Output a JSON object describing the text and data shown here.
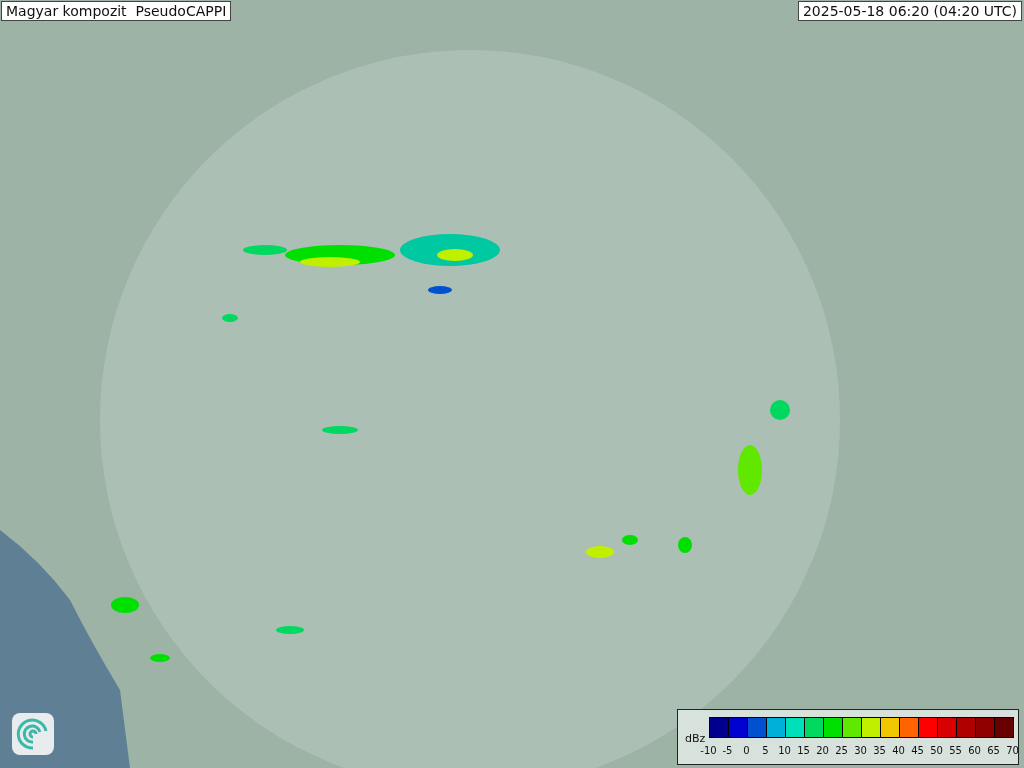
{
  "title": "Magyar kompozit  PseudoCAPPI",
  "timestamp": "2025-05-18 06:20 (04:20 UTC)",
  "legend": {
    "unit": "dBz",
    "bins": [
      {
        "color": "#00008c"
      },
      {
        "color": "#0000d0"
      },
      {
        "color": "#0050d0"
      },
      {
        "color": "#00b0d8"
      },
      {
        "color": "#00e0b8"
      },
      {
        "color": "#00d860"
      },
      {
        "color": "#00e000"
      },
      {
        "color": "#60e800"
      },
      {
        "color": "#c0f000"
      },
      {
        "color": "#f0c800"
      },
      {
        "color": "#ff6400"
      },
      {
        "color": "#ff0000"
      },
      {
        "color": "#d80000"
      },
      {
        "color": "#b00000"
      },
      {
        "color": "#900000"
      },
      {
        "color": "#680000"
      }
    ],
    "ticks": [
      "-10",
      "-5",
      "0",
      "5",
      "10",
      "15",
      "20",
      "25",
      "30",
      "35",
      "40",
      "45",
      "50",
      "55",
      "60",
      "65",
      "70"
    ]
  }
}
